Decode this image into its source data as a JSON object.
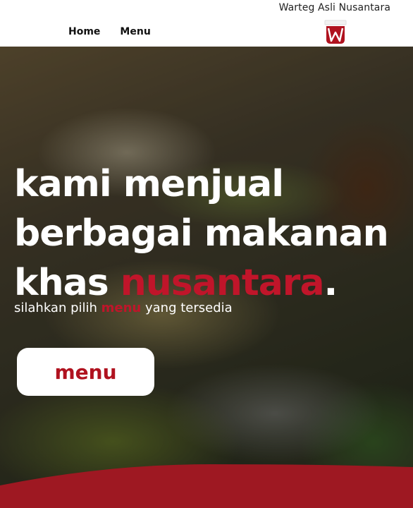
{
  "header": {
    "brand_title": "Warteg Asli Nusantara",
    "nav": {
      "home": "Home",
      "menu": "Menu"
    },
    "logo_letter": "w"
  },
  "hero": {
    "headline": {
      "line1": "kami menjual",
      "line2": "berbagai makanan",
      "line3_prefix": "khas ",
      "line3_accent": "nusantara",
      "line3_suffix": "."
    },
    "subtitle": {
      "prefix": "silahkan pilih ",
      "accent": "menu",
      "suffix": " yang tersedia"
    },
    "cta_label": "menu"
  },
  "colors": {
    "accent": "#c0152a",
    "footer_red": "#9e1822",
    "button_bg": "#ffffff"
  },
  "icons": {
    "logo": "warteg-w-logo-icon"
  }
}
